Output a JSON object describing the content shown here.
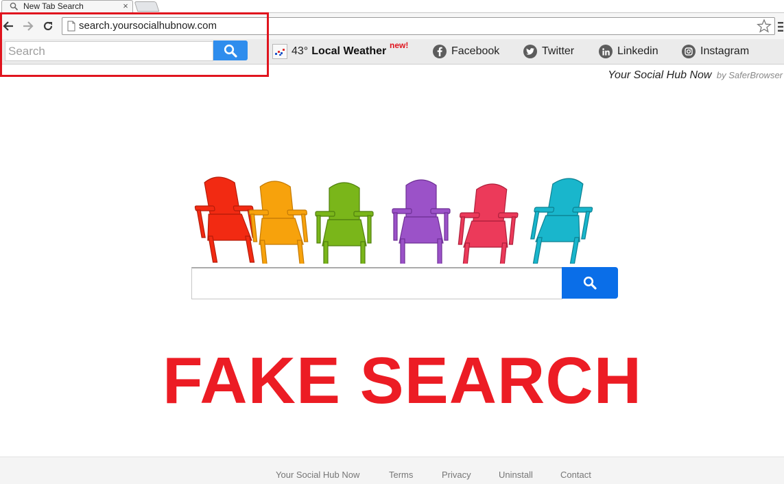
{
  "browser": {
    "tab_title": "New Tab Search",
    "tab_close": "×",
    "url": "search.yoursocialhubnow.com"
  },
  "extbar": {
    "search_placeholder": "Search",
    "weather_temp": "43°",
    "weather_label": "Local Weather",
    "weather_badge": "new!",
    "social": [
      {
        "label": "Facebook",
        "icon": "facebook-icon"
      },
      {
        "label": "Twitter",
        "icon": "twitter-icon"
      },
      {
        "label": "Linkedin",
        "icon": "linkedin-icon"
      },
      {
        "label": "Instagram",
        "icon": "instagram-icon"
      }
    ]
  },
  "brand": {
    "name": "Your Social Hub Now",
    "by": "by SaferBrowser"
  },
  "main": {
    "search_value": "",
    "overlay_text": "FAKE SEARCH"
  },
  "footer": {
    "links": [
      "Your Social Hub Now",
      "Terms",
      "Privacy",
      "Uninstall",
      "Contact"
    ]
  },
  "colors": {
    "highlight": "#e0141e",
    "ext_search_button": "#2f8ded",
    "main_search_button": "#0a6ee8",
    "overlay_text": "#ec1c24",
    "chair_colors": [
      "#f22a12",
      "#f7a20c",
      "#7ab61a",
      "#9b52c8",
      "#ec3a5a",
      "#19b6cc"
    ]
  }
}
